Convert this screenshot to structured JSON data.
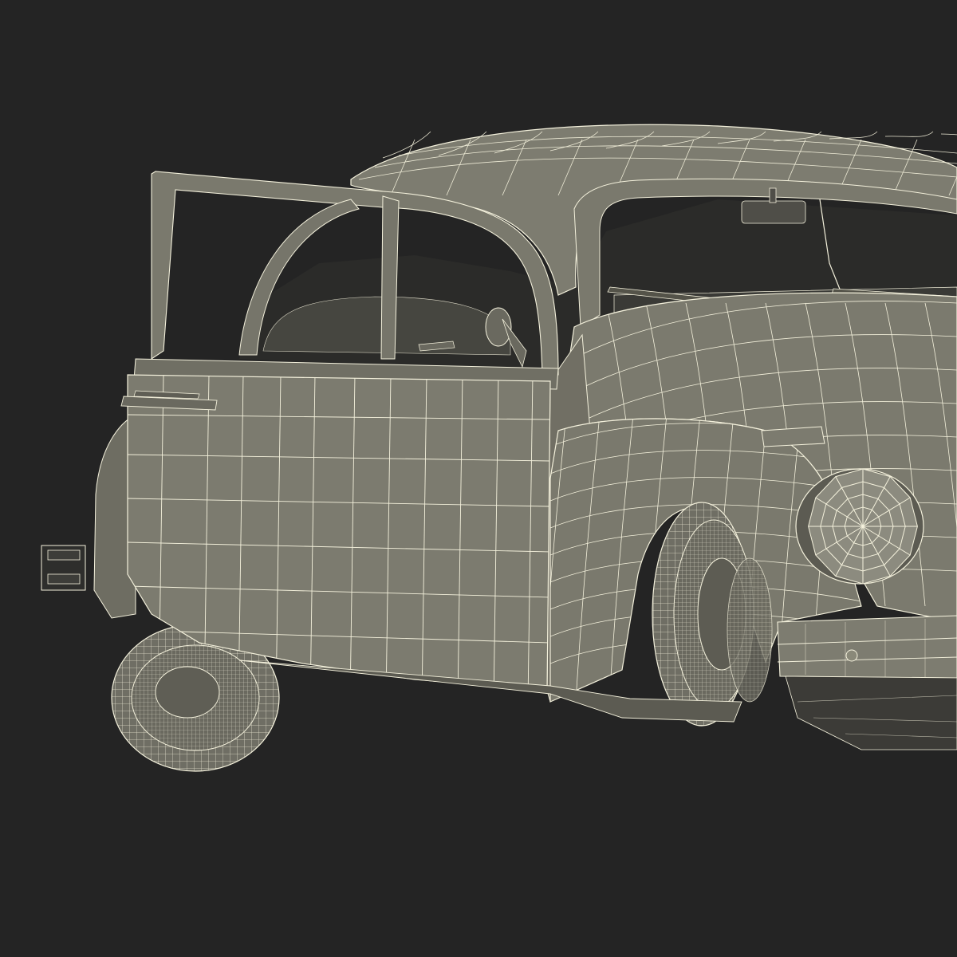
{
  "scene": {
    "subject": "wireframe-car-render",
    "colors": {
      "background": "#242424",
      "body": "#7c7b6f",
      "body_dark": "#5c5b52",
      "body_light": "#8c8b7f",
      "wire": "#f4f1dc",
      "interior": "#2b2b29",
      "tire": "#6f6e64"
    }
  }
}
